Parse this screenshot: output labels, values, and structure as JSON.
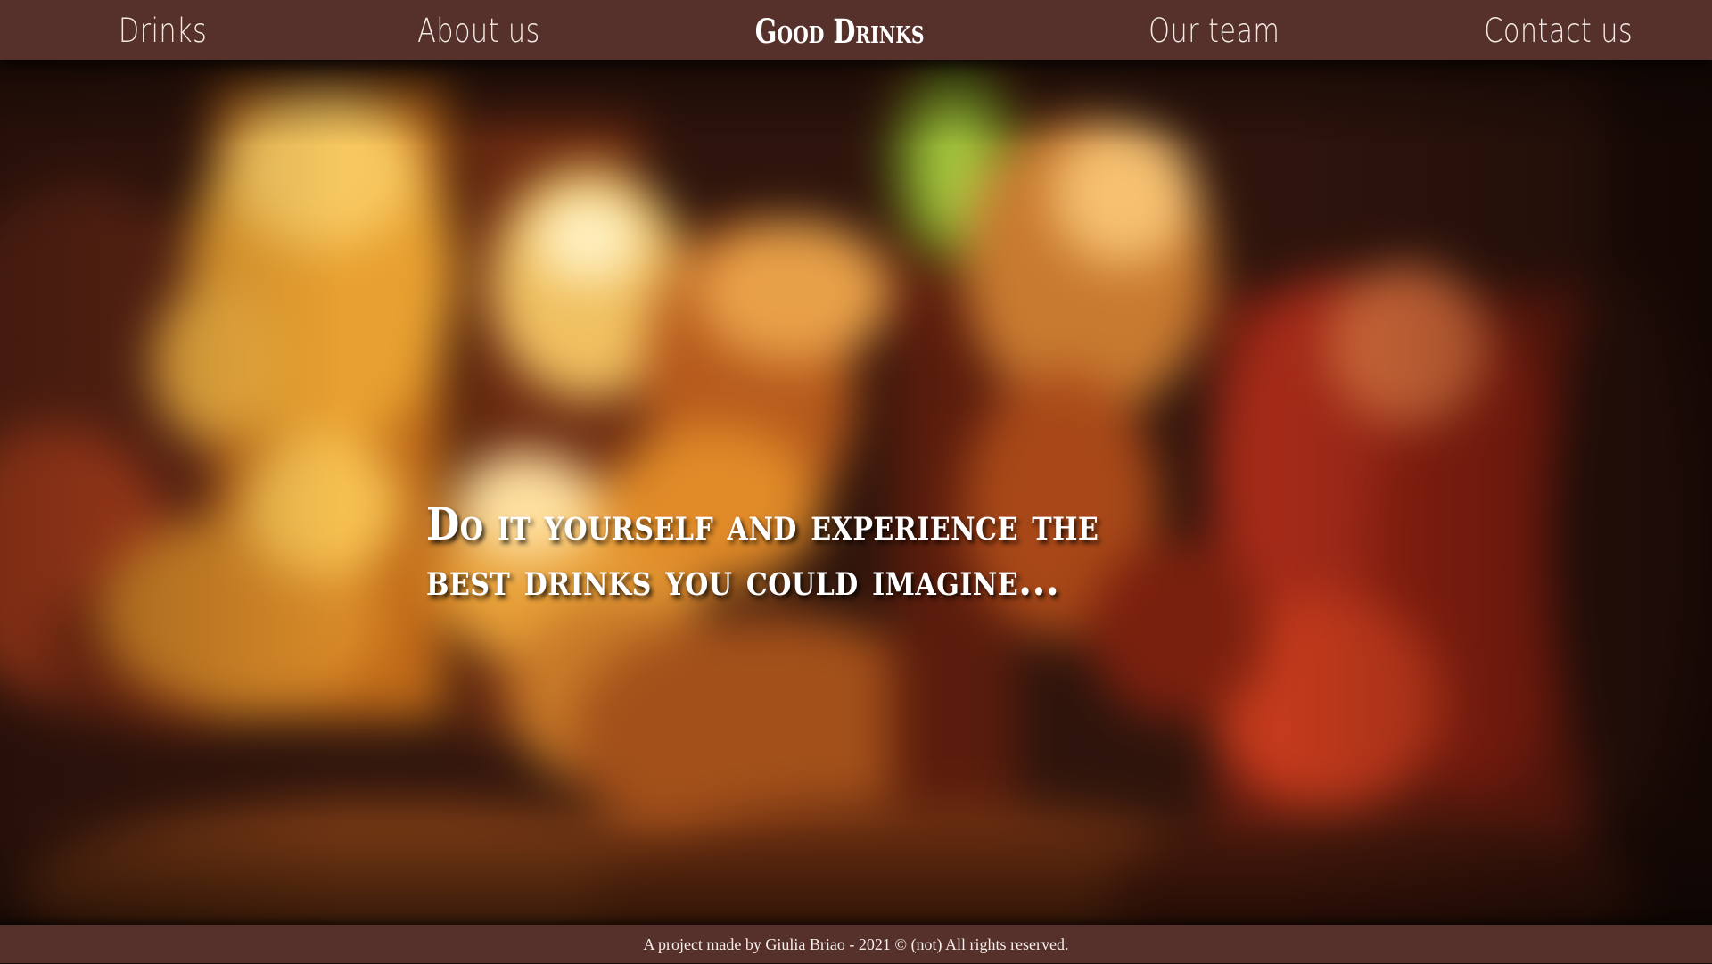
{
  "nav": {
    "drinks": "Drinks",
    "about": "About us",
    "brand": "Good Drinks",
    "team": "Our team",
    "contact": "Contact us"
  },
  "hero": {
    "heading": "Do it yourself and experience the best drinks you could imagine..."
  },
  "footer": {
    "text": "A project made by Giulia Briao - 2021 © (not) All rights reserved."
  },
  "colors": {
    "bar": "#56302a",
    "text": "#ffffff"
  }
}
